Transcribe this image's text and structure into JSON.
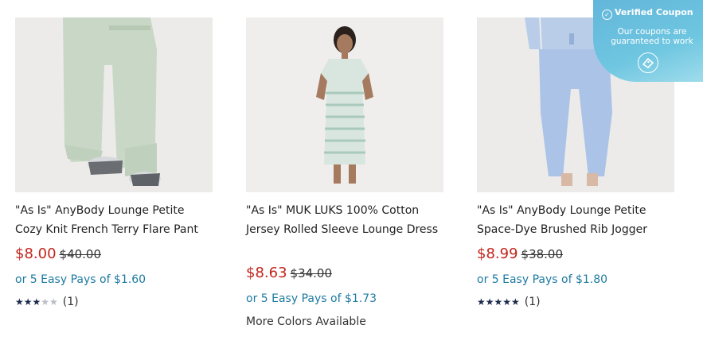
{
  "products": [
    {
      "title": "\"As Is\" AnyBody Lounge Petite Cozy Knit French Terry Flare Pant",
      "price": "$8.00",
      "original_price": "$40.00",
      "easy_pay": "or 5 Easy Pays of $1.60",
      "rating": 3,
      "rating_max": 5,
      "rating_stars_on": "★★★",
      "rating_stars_off": "★★",
      "review_count": "(1)"
    },
    {
      "title": "\"As Is\" MUK LUKS 100% Cotton Jersey Rolled Sleeve Lounge Dress",
      "price": "$8.63",
      "original_price": "$34.00",
      "easy_pay": "or 5 Easy Pays of $1.73",
      "more_colors": "More Colors Available"
    },
    {
      "title": "\"As Is\" AnyBody Lounge Petite Space-Dye Brushed Rib Jogger",
      "price": "$8.99",
      "original_price": "$38.00",
      "easy_pay": "or 5 Easy Pays of $1.80",
      "rating": 5,
      "rating_max": 5,
      "rating_stars_on": "★★★★★",
      "review_count": "(1)"
    }
  ],
  "coupon": {
    "title": "Verified Coupon",
    "subtitle": "Our coupons are guaranteed to work",
    "icon": "ticket-icon"
  },
  "colors": {
    "price": "#c2261c",
    "easy_pay": "#1e7aa1",
    "star": "#1b2a4a",
    "coupon_bg": "#6ec6e0"
  }
}
